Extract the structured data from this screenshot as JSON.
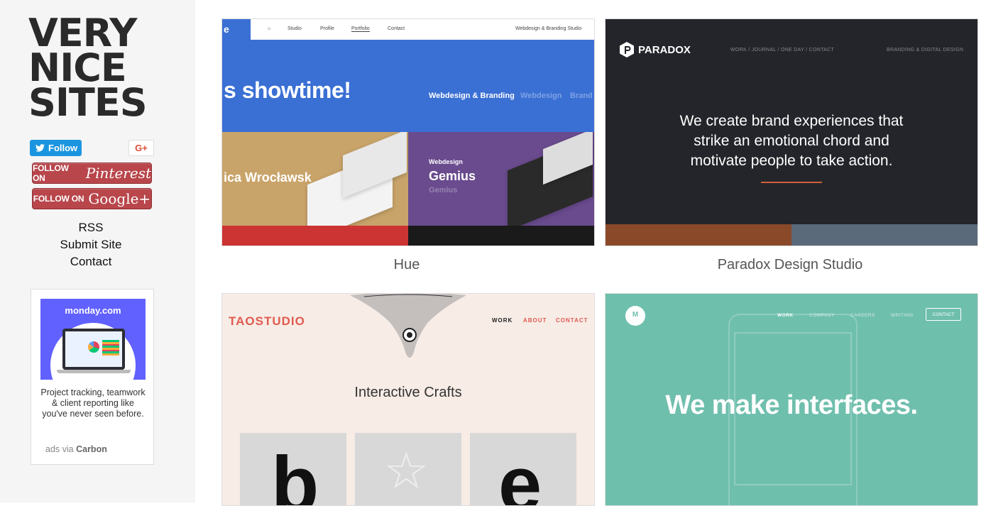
{
  "sidebar": {
    "logo_lines": [
      "VERY",
      "NICE",
      "SITES"
    ],
    "twitter_label": "Follow",
    "gplus_label": "G+",
    "pinterest": {
      "prefix": "FOLLOW ON",
      "brand": "Pinterest"
    },
    "googleplus": {
      "prefix": "FOLLOW ON",
      "brand": "Google+"
    },
    "links": [
      "RSS",
      "Submit Site",
      "Contact"
    ],
    "ad": {
      "brand": "monday.com",
      "text": "Project tracking, teamwork & client reporting like you've never seen before.",
      "via_prefix": "ads via",
      "via_name": "Carbon"
    }
  },
  "sites": [
    {
      "caption": "Hue",
      "preview": {
        "tab": "e",
        "nav": [
          "Studio",
          "Profile",
          "Portfolio",
          "Contact"
        ],
        "nav_right": "Webdesign & Branding Studio",
        "headline": "s showtime!",
        "sub": [
          "Webdesign & Branding",
          "Webdesign",
          "Brand"
        ],
        "left_title": "ica Wrocławsk",
        "right_kicker": "Webdesign",
        "right_title": "Gemius",
        "right_sub": "Gemius"
      }
    },
    {
      "caption": "Paradox Design Studio",
      "preview": {
        "logo": "PARADOX",
        "nav": "WORK  /  JOURNAL  /  ONE DAY  /  CONTACT",
        "nav_right": "BRANDING & DIGITAL DESIGN",
        "headline_lines": [
          "We create brand experiences that",
          "strike an emotional chord and",
          "motivate people to take action."
        ]
      }
    },
    {
      "caption": "",
      "preview": {
        "logo": "TAOSTUDIO",
        "nav": [
          "WORK",
          "ABOUT",
          "CONTACT"
        ],
        "headline": "Interactive Crafts",
        "letters": [
          "b",
          "☆",
          "e"
        ]
      }
    },
    {
      "caption": "",
      "preview": {
        "logo_letter": "M",
        "nav": [
          "WORK",
          "COMPANY",
          "CAREERS",
          "WRITING"
        ],
        "contact": "CONTACT",
        "headline": "We make interfaces."
      }
    }
  ],
  "colors": {
    "sidebar_bg": "#f5f5f5",
    "twitter": "#1b95e0",
    "follow_pill": "#b8464b",
    "hue_blue": "#3a6fd4",
    "paradox_bg": "#23252a",
    "paradox_accent": "#d2603a",
    "tao_bg": "#f7ece6",
    "tao_accent": "#e05a4f",
    "mint_bg": "#6fbfad"
  },
  "icons": [
    "twitter-bird-icon",
    "home-icon",
    "paradox-logo-icon"
  ]
}
